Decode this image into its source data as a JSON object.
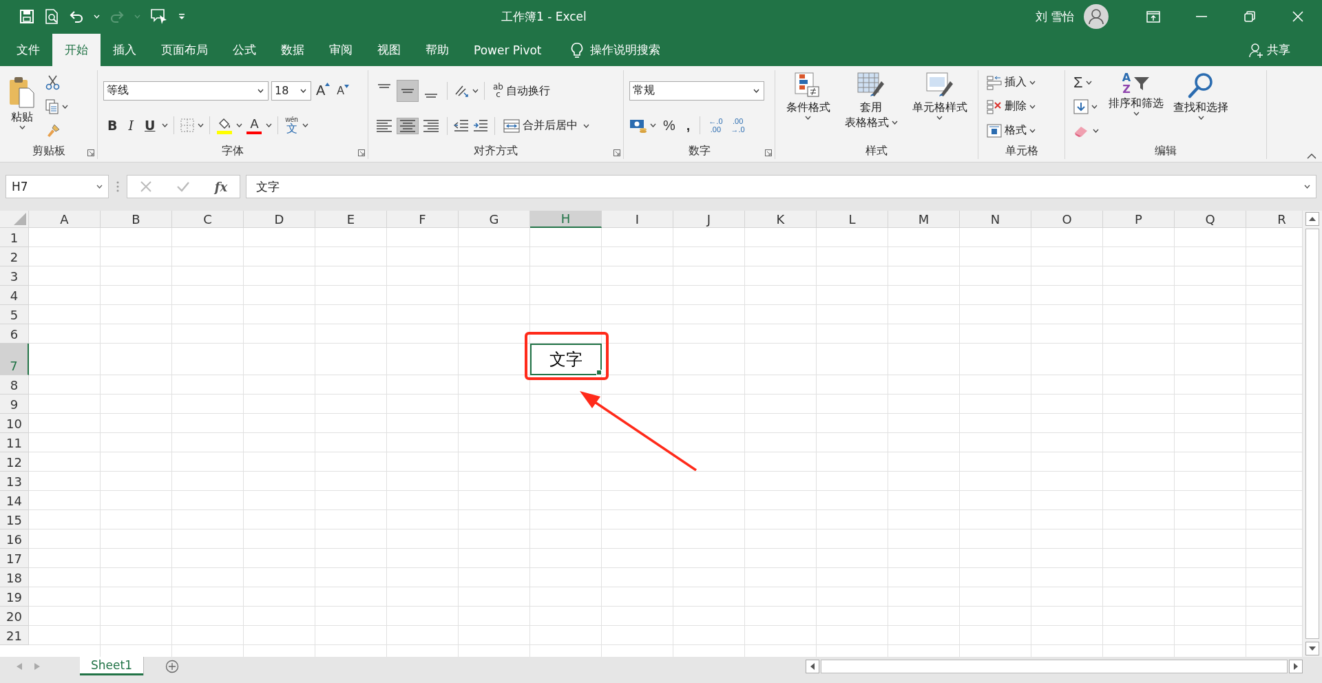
{
  "title_bar": {
    "title": "工作簿1  -  Excel",
    "user": "刘 雪怡"
  },
  "tabs": [
    {
      "label": "文件",
      "selected": false
    },
    {
      "label": "开始",
      "selected": true
    },
    {
      "label": "插入",
      "selected": false
    },
    {
      "label": "页面布局",
      "selected": false
    },
    {
      "label": "公式",
      "selected": false
    },
    {
      "label": "数据",
      "selected": false
    },
    {
      "label": "审阅",
      "selected": false
    },
    {
      "label": "视图",
      "selected": false
    },
    {
      "label": "帮助",
      "selected": false
    },
    {
      "label": "Power Pivot",
      "selected": false
    }
  ],
  "tell_me": "操作说明搜索",
  "share": "共享",
  "ribbon": {
    "clipboard": {
      "paste": "粘贴",
      "label": "剪贴板"
    },
    "font": {
      "name": "等线",
      "size": "18",
      "styles": [
        "B",
        "I",
        "U"
      ],
      "grow": "A",
      "shrink": "A",
      "color_letter": "A",
      "phonetic": "wén",
      "phonetic_char": "文",
      "label": "字体"
    },
    "alignment": {
      "vertical": [
        {
          "selected": false
        },
        {
          "selected": true
        },
        {
          "selected": false
        }
      ],
      "horizontal": [
        {
          "selected": false
        },
        {
          "selected": true
        },
        {
          "selected": false
        }
      ],
      "wrap_icon": [
        "ab",
        "c"
      ],
      "wrap": "自动换行",
      "merge": "合并后居中",
      "label": "对齐方式"
    },
    "number": {
      "format": "常规",
      "percent": "%",
      "comma": ",",
      "decimals": [
        [
          "←.0",
          ".00"
        ],
        [
          ".00",
          "→.0"
        ]
      ],
      "label": "数字"
    },
    "styles": {
      "buttons": [
        [
          "条件格式"
        ],
        [
          "套用",
          "表格格式"
        ],
        [
          "单元格样式"
        ]
      ],
      "label": "样式"
    },
    "cells": {
      "buttons": [
        "插入",
        "删除",
        "格式"
      ],
      "label": "单元格"
    },
    "editing": {
      "sum": "Σ",
      "sort": "排序和筛选",
      "sort_icon": [
        "A",
        "Z"
      ],
      "find": "查找和选择",
      "label": "编辑"
    }
  },
  "formula_bar": {
    "name_box": "H7",
    "fx": "fx",
    "content": "文字"
  },
  "sheet": {
    "columns": [
      {
        "label": "A",
        "selected": false
      },
      {
        "label": "B",
        "selected": false
      },
      {
        "label": "C",
        "selected": false
      },
      {
        "label": "D",
        "selected": false
      },
      {
        "label": "E",
        "selected": false
      },
      {
        "label": "F",
        "selected": false
      },
      {
        "label": "G",
        "selected": false
      },
      {
        "label": "H",
        "selected": true
      },
      {
        "label": "I",
        "selected": false
      },
      {
        "label": "J",
        "selected": false
      },
      {
        "label": "K",
        "selected": false
      },
      {
        "label": "L",
        "selected": false
      },
      {
        "label": "M",
        "selected": false
      },
      {
        "label": "N",
        "selected": false
      },
      {
        "label": "O",
        "selected": false
      },
      {
        "label": "P",
        "selected": false
      },
      {
        "label": "Q",
        "selected": false
      },
      {
        "label": "R",
        "selected": false
      }
    ],
    "rows": [
      {
        "label": "1",
        "selected": false
      },
      {
        "label": "2",
        "selected": false
      },
      {
        "label": "3",
        "selected": false
      },
      {
        "label": "4",
        "selected": false
      },
      {
        "label": "5",
        "selected": false
      },
      {
        "label": "6",
        "selected": false
      },
      {
        "label": "7",
        "selected": true
      },
      {
        "label": "8",
        "selected": false
      },
      {
        "label": "9",
        "selected": false
      },
      {
        "label": "10",
        "selected": false
      },
      {
        "label": "11",
        "selected": false
      },
      {
        "label": "12",
        "selected": false
      },
      {
        "label": "13",
        "selected": false
      },
      {
        "label": "14",
        "selected": false
      },
      {
        "label": "15",
        "selected": false
      },
      {
        "label": "16",
        "selected": false
      },
      {
        "label": "17",
        "selected": false
      },
      {
        "label": "18",
        "selected": false
      },
      {
        "label": "19",
        "selected": false
      },
      {
        "label": "20",
        "selected": false
      },
      {
        "label": "21",
        "selected": false
      }
    ],
    "active_cell": {
      "text": "文字"
    }
  },
  "sheet_tabs": [
    {
      "label": "Sheet1",
      "selected": true
    }
  ]
}
